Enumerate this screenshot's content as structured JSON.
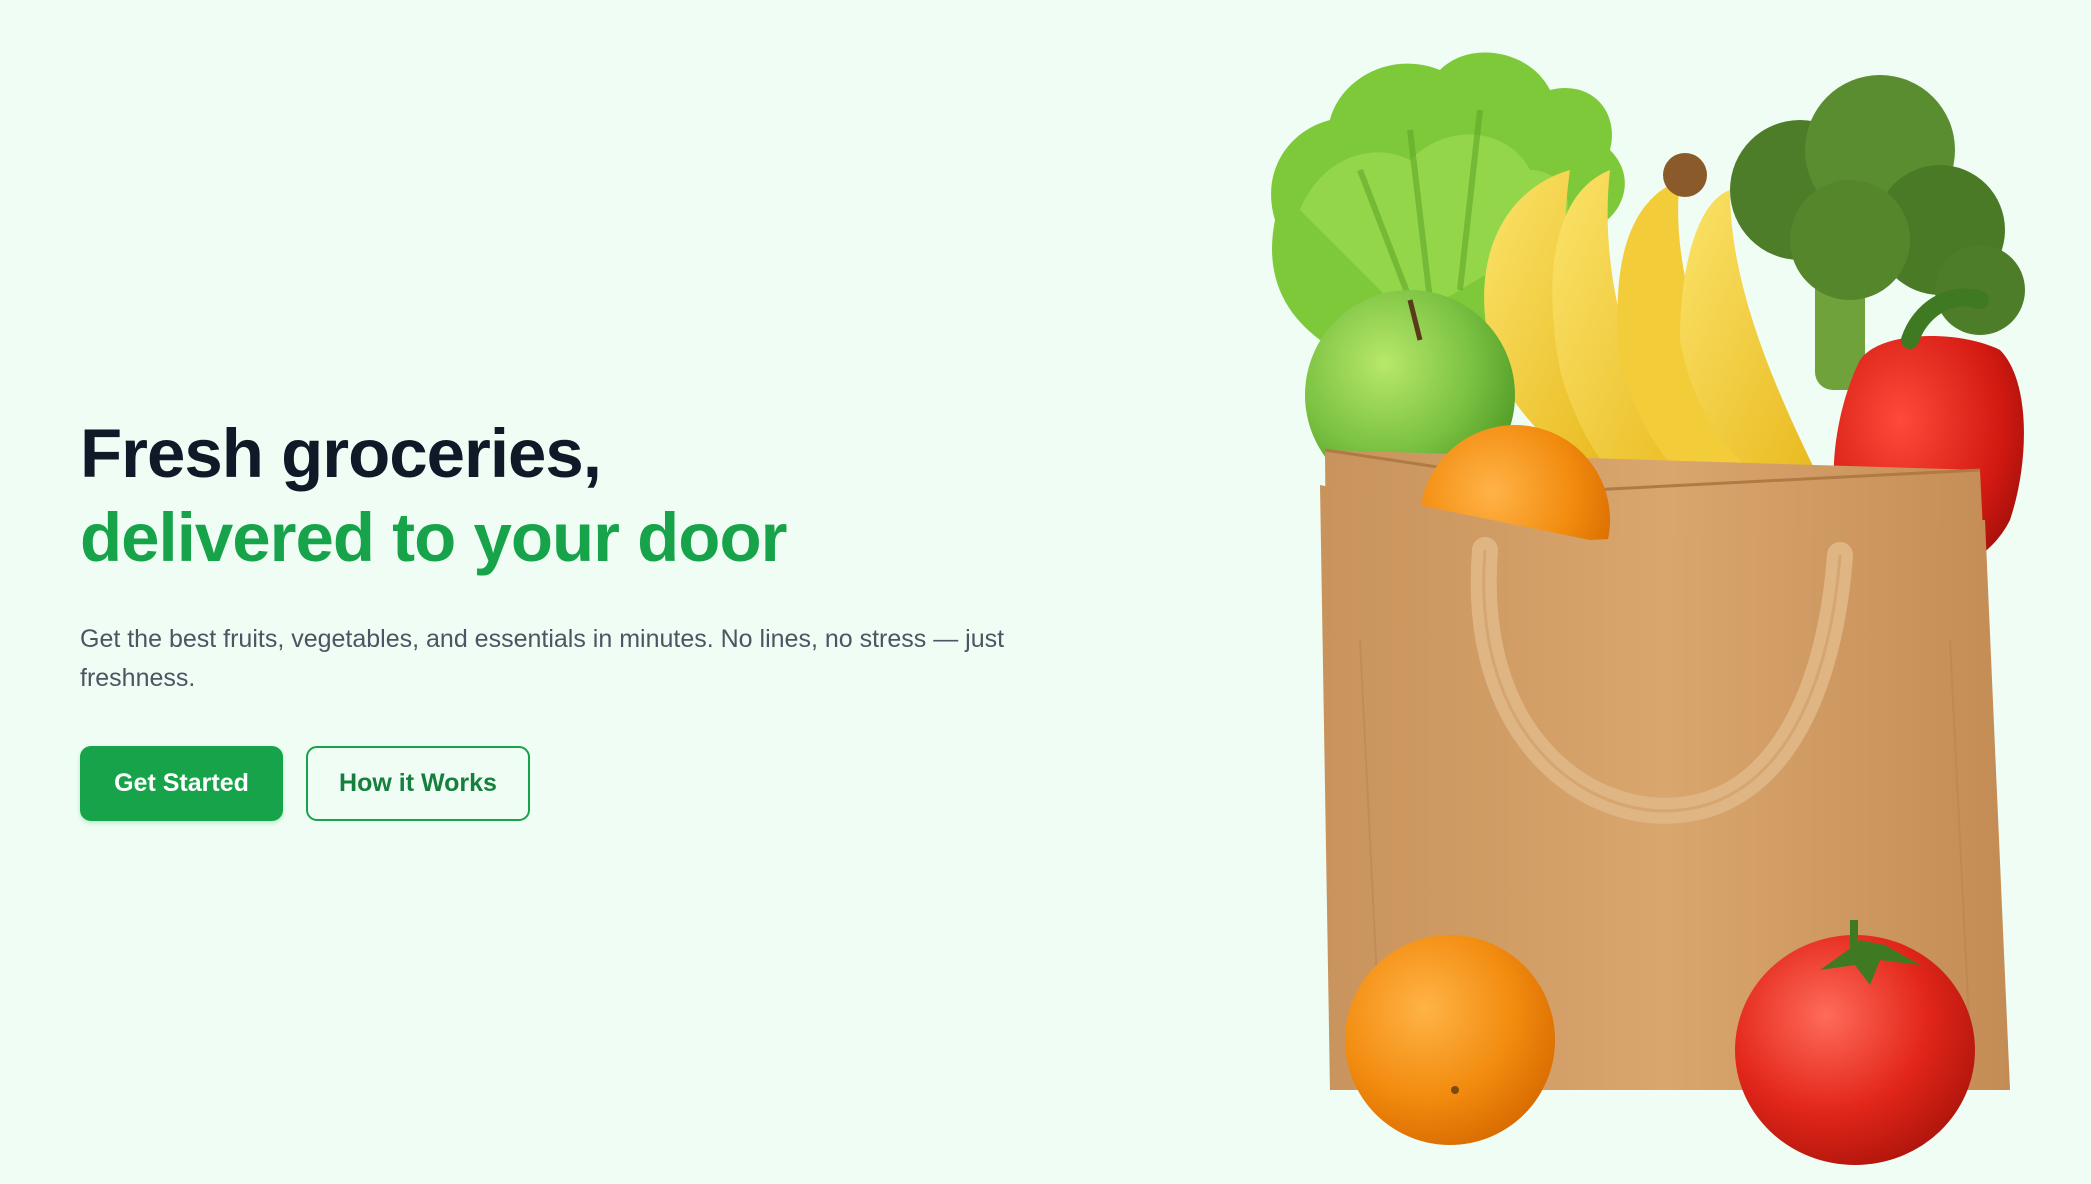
{
  "hero": {
    "headline_line1": "Fresh groceries,",
    "headline_line2": "delivered to your door",
    "subtext": "Get the best fruits, vegetables, and essentials in minutes. No lines, no stress — just freshness.",
    "primary_button": "Get Started",
    "secondary_button": "How it Works"
  },
  "image": {
    "subject": "grocery-bag-icon",
    "alt": "Paper grocery bag filled with lettuce, bananas, broccoli, apple, orange, bell pepper and tomato"
  },
  "colors": {
    "background": "#f0fdf4",
    "accent": "#16a34a",
    "heading": "#111827",
    "body_text": "#4b5563"
  }
}
